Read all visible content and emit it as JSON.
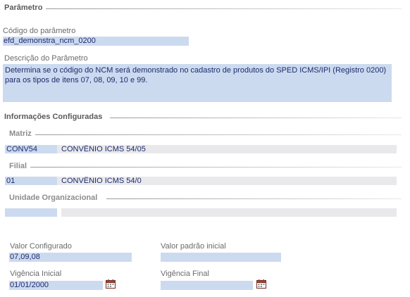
{
  "parametro": {
    "section_title": "Parâmetro",
    "codigo_label": "Código do parâmetro",
    "codigo_value": "efd_demonstra_ncm_0200",
    "descricao_label": "Descrição do Parâmetro",
    "descricao_value": "Determina se o código do NCM será demonstrado no cadastro de produtos do SPED ICMS/IPI (Registro 0200) para os tipos de itens 07, 08, 09, 10 e 99."
  },
  "informacoes": {
    "section_title": "Informações Configuradas",
    "matriz": {
      "title": "Matriz",
      "code": "CONV54",
      "description": "CONVÊNIO ICMS 54/05"
    },
    "filial": {
      "title": "Filial",
      "code": "01",
      "description": "CONVÊNIO ICMS 54/0"
    },
    "unidade": {
      "title": "Unidade Organizacional",
      "code": "",
      "description": ""
    }
  },
  "valores": {
    "valor_configurado_label": "Valor Configurado",
    "valor_configurado_value": "07,09,08",
    "valor_padrao_label": "Valor padrão inicial",
    "valor_padrao_value": "",
    "vigencia_inicial_label": "Vigência Inicial",
    "vigencia_inicial_value": "01/01/2000",
    "vigencia_final_label": "Vigência Final",
    "vigencia_final_value": ""
  },
  "icons": {
    "calendar": "calendar-icon"
  },
  "colors": {
    "field_blue": "#ccdaf0",
    "field_grey": "#e9e9ec",
    "text": "#1d2a6b",
    "calendar_red": "#c0392b"
  }
}
